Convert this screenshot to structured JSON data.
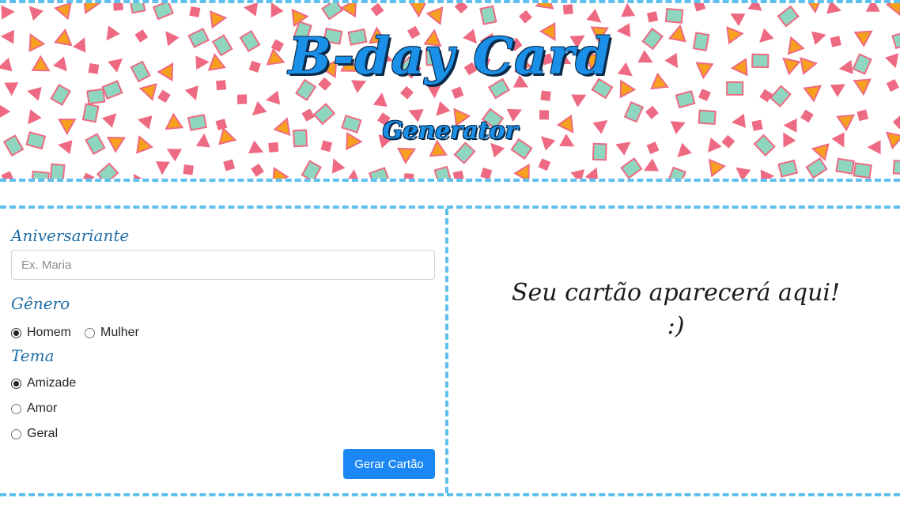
{
  "header": {
    "title": "B-day Card",
    "subtitle": "Generator"
  },
  "form": {
    "name_label": "Aniversariante",
    "name_placeholder": "Ex. Maria",
    "name_value": "",
    "gender_label": "Gênero",
    "gender_options": [
      {
        "label": "Homem",
        "checked": true
      },
      {
        "label": "Mulher",
        "checked": false
      }
    ],
    "theme_label": "Tema",
    "theme_options": [
      {
        "label": "Amizade",
        "checked": true
      },
      {
        "label": "Amor",
        "checked": false
      },
      {
        "label": "Geral",
        "checked": false
      }
    ],
    "submit_label": "Gerar Cartão"
  },
  "preview": {
    "line1": "Seu cartão aparecerá aqui!",
    "line2": ":)"
  },
  "colors": {
    "accent": "#1b87f5",
    "dashed_border": "#5fbfed",
    "title_blue": "#1a90e8",
    "label_blue": "#1f6fa8",
    "confetti_pink": "#ee6a82",
    "confetti_orange": "#f7a01e",
    "confetti_mint": "#8fd6c0"
  }
}
